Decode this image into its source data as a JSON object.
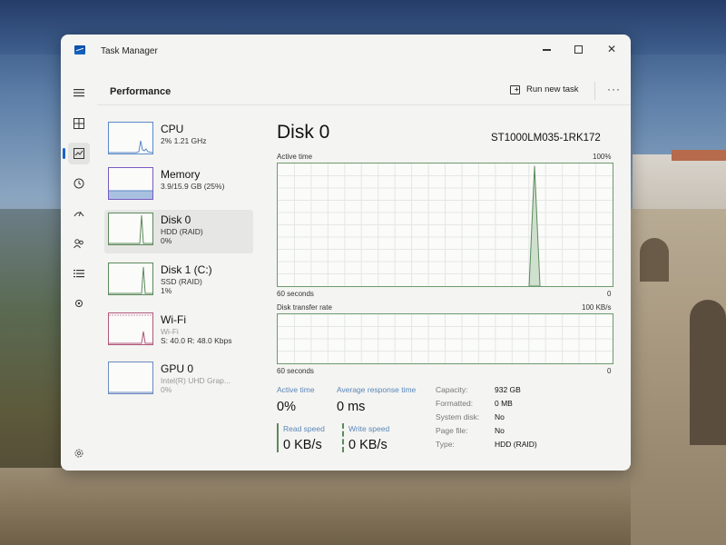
{
  "window": {
    "title": "Task Manager"
  },
  "header": {
    "title": "Performance",
    "run_new_task": "Run new task",
    "more": "···"
  },
  "devices": [
    {
      "name": "CPU",
      "sub": "2% 1.21 GHz",
      "sub2": ""
    },
    {
      "name": "Memory",
      "sub": "3.9/15.9 GB (25%)",
      "sub2": ""
    },
    {
      "name": "Disk 0",
      "sub": "HDD (RAID)",
      "sub2": "0%"
    },
    {
      "name": "Disk 1 (C:)",
      "sub": "SSD (RAID)",
      "sub2": "1%"
    },
    {
      "name": "Wi-Fi",
      "sub": "Wi-Fi",
      "sub2": "S: 40.0 R: 48.0 Kbps"
    },
    {
      "name": "GPU 0",
      "sub": "Intel(R) UHD Grap...",
      "sub2": "0%"
    }
  ],
  "main": {
    "title": "Disk 0",
    "model": "ST1000LM035-1RK172",
    "active_time_chart": {
      "label": "Active time",
      "max_label": "100%",
      "x_left": "60 seconds",
      "x_right": "0",
      "peak_fraction": 0.98
    },
    "transfer_chart": {
      "label": "Disk transfer rate",
      "max_label": "100 KB/s",
      "x_left": "60 seconds",
      "x_right": "0"
    },
    "stats": {
      "active_time_label": "Active time",
      "active_time_value": "0%",
      "avg_resp_label": "Average response time",
      "avg_resp_value": "0 ms",
      "read_label": "Read speed",
      "read_value": "0 KB/s",
      "write_label": "Write speed",
      "write_value": "0 KB/s"
    },
    "properties": [
      {
        "key": "Capacity:",
        "value": "932 GB"
      },
      {
        "key": "Formatted:",
        "value": "0 MB"
      },
      {
        "key": "System disk:",
        "value": "No"
      },
      {
        "key": "Page file:",
        "value": "No"
      },
      {
        "key": "Type:",
        "value": "HDD (RAID)"
      }
    ]
  },
  "colors": {
    "accent": "#1a63c9",
    "disk_green": "#5c8a5c",
    "cpu_blue": "#5a8ac7"
  }
}
